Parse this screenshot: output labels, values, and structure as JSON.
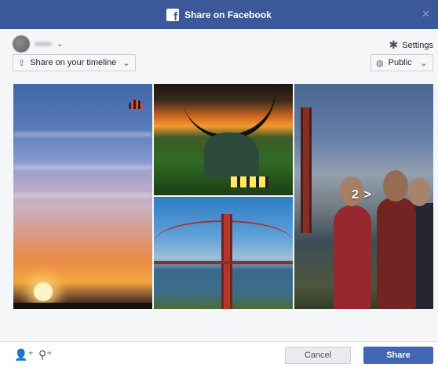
{
  "dialog": {
    "title": "Share on Facebook",
    "close_icon": "close-icon",
    "accent_color": "#3b5998"
  },
  "account": {
    "avatar": "avatar",
    "chevron_icon": "chevron-down-icon"
  },
  "settings": {
    "label": "Settings",
    "icon": "gear-icon"
  },
  "share_target": {
    "selected": "Share on your timeline",
    "icon": "share-icon"
  },
  "privacy": {
    "selected": "Public",
    "icon": "globe-icon"
  },
  "photos": {
    "more_label": "2 >"
  },
  "footer": {
    "tag_icon": "tag-friends-icon",
    "location_icon": "location-pin-icon",
    "cancel_label": "Cancel",
    "share_label": "Share",
    "share_color": "#4267b2"
  }
}
